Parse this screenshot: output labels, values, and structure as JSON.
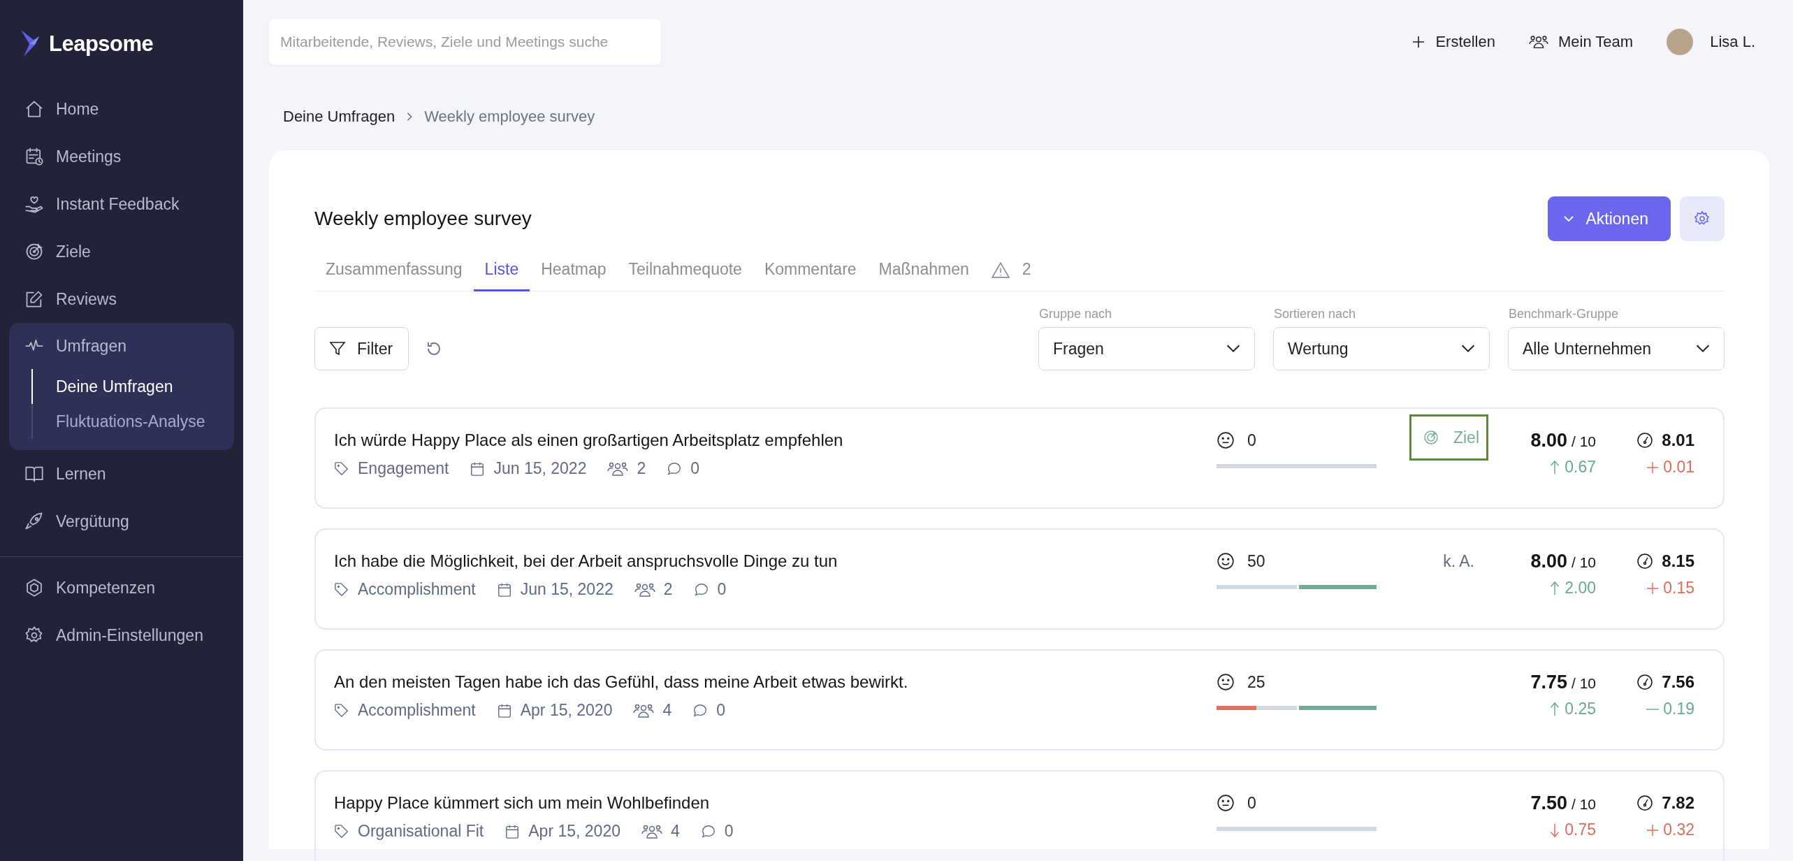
{
  "sidebar": {
    "logo": "Leapsome",
    "main": [
      {
        "label": "Home",
        "selected": false
      },
      {
        "label": "Meetings",
        "selected": false
      },
      {
        "label": "Instant Feedback",
        "selected": false
      },
      {
        "label": "Ziele",
        "selected": false
      },
      {
        "label": "Reviews",
        "selected": false
      },
      {
        "label": "Umfragen",
        "selected": true,
        "expanded": true,
        "children": [
          {
            "label": "Deine Umfragen",
            "selected": true
          },
          {
            "label": "Fluktuations-Analyse",
            "selected": false
          }
        ]
      },
      {
        "label": "Lernen",
        "selected": false
      },
      {
        "label": "Vergütung",
        "selected": false
      }
    ],
    "admin": [
      {
        "label": "Kompetenzen",
        "selected": false
      },
      {
        "label": "Admin-Einstellungen",
        "selected": false
      }
    ]
  },
  "topbar": {
    "search": {
      "placeholder": "Mitarbeitende, Reviews, Ziele und Meetings suche"
    },
    "create": "Erstellen",
    "team": "Mein Team",
    "user": "Lisa L."
  },
  "breadcrumb": [
    "Deine Umfragen",
    "Weekly employee survey"
  ],
  "survey": {
    "title": "Weekly employee survey",
    "actions_button": "Aktionen",
    "tabs": [
      {
        "kind": "text",
        "label": "Zusammenfassung",
        "selected": false
      },
      {
        "kind": "text",
        "label": "Liste",
        "selected": true
      },
      {
        "kind": "text",
        "label": "Heatmap",
        "selected": false
      },
      {
        "kind": "text",
        "label": "Teilnahmequote",
        "selected": false
      },
      {
        "kind": "text",
        "label": "Kommentare",
        "selected": false
      },
      {
        "kind": "text",
        "label": "Maßnahmen",
        "selected": false
      },
      {
        "kind": "warning",
        "label": "2",
        "selected": false
      }
    ],
    "filter_button": "Filter",
    "selects": [
      {
        "label": "Gruppe nach",
        "value": "Fragen"
      },
      {
        "label": "Sortieren nach",
        "value": "Wertung"
      },
      {
        "label": "Benchmark-Gruppe",
        "value": "Alle Unternehmen"
      }
    ],
    "rows": [
      {
        "question": "Ich würde Happy Place als einen großartigen Arbeitsplatz empfehlen",
        "category": "Engagement",
        "date": "Jun 15, 2022",
        "participants": "2",
        "comments": "0",
        "sentiment": {
          "kind": "neutral",
          "value": "0"
        },
        "target": {
          "kind": "goal",
          "label": "Ziel",
          "highlighted": true
        },
        "score": "8.00",
        "scale": "/ 10",
        "change": {
          "kind": "up",
          "value": "0.67"
        },
        "benchmark": {
          "value": "8.01",
          "difference": {
            "kind": "above",
            "value": "0.01"
          }
        }
      },
      {
        "question": "Ich habe die Möglichkeit, bei der Arbeit anspruchsvolle Dinge zu tun",
        "category": "Accomplishment",
        "date": "Jun 15, 2022",
        "participants": "2",
        "comments": "0",
        "sentiment": {
          "kind": "happy",
          "value": "50"
        },
        "distribution": {
          "positive": {
            "level": 0.5
          }
        },
        "target": {
          "kind": "text",
          "label": "k. A.",
          "highlighted": false
        },
        "score": "8.00",
        "scale": "/ 10",
        "change": {
          "kind": "up",
          "value": "2.00"
        },
        "benchmark": {
          "value": "8.15",
          "difference": {
            "kind": "above",
            "value": "0.15"
          }
        }
      },
      {
        "question": "An den meisten Tagen habe ich das Gefühl, dass meine Arbeit etwas bewirkt.",
        "category": "Accomplishment",
        "date": "Apr 15, 2020",
        "participants": "4",
        "comments": "0",
        "sentiment": {
          "kind": "neutral",
          "value": "25"
        },
        "distribution": {
          "negative": {
            "level": 0.25
          },
          "positive": {
            "level": 0.5
          }
        },
        "score": "7.75",
        "scale": "/ 10",
        "change": {
          "kind": "up",
          "value": "0.25"
        },
        "benchmark": {
          "value": "7.56",
          "difference": {
            "kind": "below",
            "value": "0.19"
          }
        }
      },
      {
        "question": "Happy Place kümmert sich um mein Wohlbefinden",
        "category": "Organisational Fit",
        "date": "Apr 15, 2020",
        "participants": "4",
        "comments": "0",
        "sentiment": {
          "kind": "neutral",
          "value": "0"
        },
        "score": "7.50",
        "scale": "/ 10",
        "change": {
          "kind": "down",
          "value": "0.75"
        },
        "benchmark": {
          "value": "7.82",
          "difference": {
            "kind": "above",
            "value": "0.32"
          }
        }
      }
    ]
  }
}
